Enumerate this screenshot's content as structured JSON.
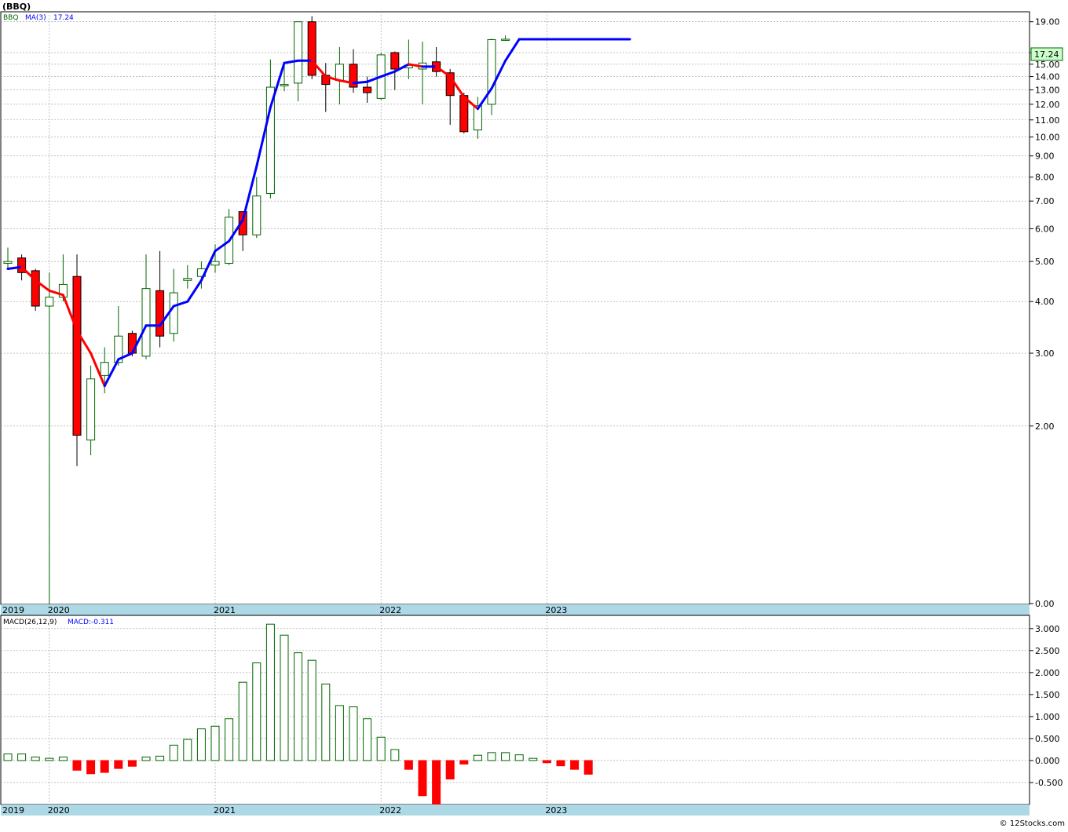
{
  "title": "(BBQ)",
  "watermark": "© 12Stocks.com",
  "colors": {
    "up": "#006400",
    "down": "#ff0000",
    "ma_up": "#0000ff",
    "ma_down": "#ff0000",
    "grid": "#999999",
    "xband": "#add8e6",
    "last_bg": "#ccffcc"
  },
  "price_panel": {
    "symbol_label": "BBQ",
    "ma_label": "MA(3)",
    "ma_value": "17.24",
    "last_price_label": "17.24",
    "scale": "log",
    "y_ticks": [
      "19.00",
      "16.00",
      "15.00",
      "14.00",
      "13.00",
      "12.00",
      "11.00",
      "10.00",
      "9.00",
      "8.00",
      "7.00",
      "6.00",
      "5.00",
      "4.00",
      "3.00",
      "2.00",
      "0.00"
    ]
  },
  "macd_panel": {
    "label": "MACD(26,12,9)",
    "value_label": "MACD:-0.311",
    "y_ticks": [
      "3.000",
      "2.500",
      "2.000",
      "1.500",
      "1.000",
      "0.500",
      "0.000",
      "-0.500"
    ]
  },
  "x_labels": [
    "2019",
    "2020",
    "2021",
    "2022",
    "2023"
  ],
  "chart_data": [
    {
      "type": "candlestick",
      "interval": "monthly",
      "scale": "log",
      "candles": [
        {
          "date": "2019-12",
          "open": 4.95,
          "high": 5.4,
          "low": 4.8,
          "close": 5.0
        },
        {
          "date": "2020-01",
          "open": 5.1,
          "high": 5.2,
          "low": 4.5,
          "close": 4.7
        },
        {
          "date": "2020-02",
          "open": 4.75,
          "high": 4.8,
          "low": 3.8,
          "close": 3.9
        },
        {
          "date": "2020-03",
          "open": 3.9,
          "high": 4.7,
          "low": 0.7,
          "close": 4.1
        },
        {
          "date": "2020-04",
          "open": 4.1,
          "high": 5.2,
          "low": 4.0,
          "close": 4.4
        },
        {
          "date": "2020-05",
          "open": 4.6,
          "high": 5.2,
          "low": 1.6,
          "close": 1.9
        },
        {
          "date": "2020-06",
          "open": 1.85,
          "high": 2.8,
          "low": 1.7,
          "close": 2.6
        },
        {
          "date": "2020-07",
          "open": 2.65,
          "high": 3.1,
          "low": 2.4,
          "close": 2.85
        },
        {
          "date": "2020-08",
          "open": 2.85,
          "high": 3.9,
          "low": 2.8,
          "close": 3.3
        },
        {
          "date": "2020-09",
          "open": 3.35,
          "high": 3.4,
          "low": 2.95,
          "close": 3.0
        },
        {
          "date": "2020-10",
          "open": 2.95,
          "high": 5.2,
          "low": 2.9,
          "close": 4.3
        },
        {
          "date": "2020-11",
          "open": 4.25,
          "high": 5.3,
          "low": 3.1,
          "close": 3.3
        },
        {
          "date": "2020-12",
          "open": 3.35,
          "high": 4.8,
          "low": 3.2,
          "close": 4.2
        },
        {
          "date": "2021-01",
          "open": 4.5,
          "high": 4.9,
          "low": 4.3,
          "close": 4.55
        },
        {
          "date": "2021-02",
          "open": 4.6,
          "high": 5.0,
          "low": 4.3,
          "close": 4.8
        },
        {
          "date": "2021-03",
          "open": 4.9,
          "high": 5.5,
          "low": 4.7,
          "close": 5.0
        },
        {
          "date": "2021-04",
          "open": 4.95,
          "high": 6.7,
          "low": 4.9,
          "close": 6.4
        },
        {
          "date": "2021-05",
          "open": 6.6,
          "high": 6.6,
          "low": 5.3,
          "close": 5.8
        },
        {
          "date": "2021-06",
          "open": 5.8,
          "high": 8.0,
          "low": 5.7,
          "close": 7.2
        },
        {
          "date": "2021-07",
          "open": 7.3,
          "high": 15.4,
          "low": 7.1,
          "close": 13.2
        },
        {
          "date": "2021-08",
          "open": 13.3,
          "high": 15.2,
          "low": 12.9,
          "close": 13.4
        },
        {
          "date": "2021-09",
          "open": 13.5,
          "high": 19.0,
          "low": 12.2,
          "close": 19.0
        },
        {
          "date": "2021-10",
          "open": 19.0,
          "high": 19.6,
          "low": 13.8,
          "close": 14.1
        },
        {
          "date": "2021-11",
          "open": 14.1,
          "high": 15.1,
          "low": 11.5,
          "close": 13.4
        },
        {
          "date": "2021-12",
          "open": 13.7,
          "high": 16.5,
          "low": 12.0,
          "close": 15.0
        },
        {
          "date": "2022-01",
          "open": 15.0,
          "high": 16.3,
          "low": 12.8,
          "close": 13.2
        },
        {
          "date": "2022-02",
          "open": 13.2,
          "high": 14.0,
          "low": 12.1,
          "close": 12.8
        },
        {
          "date": "2022-03",
          "open": 12.4,
          "high": 16.0,
          "low": 12.3,
          "close": 15.8
        },
        {
          "date": "2022-04",
          "open": 16.0,
          "high": 16.1,
          "low": 13.0,
          "close": 14.6
        },
        {
          "date": "2022-05",
          "open": 14.7,
          "high": 17.2,
          "low": 13.8,
          "close": 14.9
        },
        {
          "date": "2022-06",
          "open": 14.6,
          "high": 17.0,
          "low": 12.0,
          "close": 15.1
        },
        {
          "date": "2022-07",
          "open": 15.2,
          "high": 16.5,
          "low": 14.0,
          "close": 14.4
        },
        {
          "date": "2022-08",
          "open": 14.3,
          "high": 14.6,
          "low": 10.7,
          "close": 12.6
        },
        {
          "date": "2022-09",
          "open": 12.6,
          "high": 12.8,
          "low": 10.2,
          "close": 10.3
        },
        {
          "date": "2022-10",
          "open": 10.4,
          "high": 12.5,
          "low": 9.9,
          "close": 11.9
        },
        {
          "date": "2022-11",
          "open": 12.0,
          "high": 17.3,
          "low": 11.3,
          "close": 17.2
        },
        {
          "date": "2022-12",
          "open": 17.2,
          "high": 17.6,
          "low": 17.1,
          "close": 17.24
        }
      ],
      "ma3": [
        4.8,
        4.85,
        4.5,
        4.25,
        4.15,
        3.4,
        3.0,
        2.5,
        2.9,
        3.0,
        3.5,
        3.5,
        3.9,
        4.0,
        4.5,
        5.3,
        5.6,
        6.3,
        8.5,
        11.8,
        15.1,
        15.3,
        15.3,
        14.0,
        13.7,
        13.5,
        13.6,
        14.0,
        14.4,
        15.0,
        14.8,
        14.8,
        14.0,
        12.5,
        11.7,
        13.1,
        15.3,
        17.24,
        17.24,
        17.24,
        17.24,
        17.24,
        17.24,
        17.24,
        17.24,
        17.24
      ]
    },
    {
      "type": "bar",
      "name": "MACD(26,12,9)",
      "interval": "monthly",
      "values": [
        0.15,
        0.15,
        0.08,
        0.05,
        0.08,
        -0.22,
        -0.3,
        -0.27,
        -0.18,
        -0.13,
        0.08,
        0.1,
        0.35,
        0.48,
        0.72,
        0.78,
        0.95,
        1.78,
        2.22,
        3.1,
        2.85,
        2.45,
        2.28,
        1.74,
        1.25,
        1.22,
        0.95,
        0.53,
        0.25,
        -0.2,
        -0.8,
        -1.05,
        -0.42,
        -0.08,
        0.12,
        0.18,
        0.18,
        0.13,
        0.05,
        -0.05,
        -0.12,
        -0.2,
        -0.311
      ],
      "ylim": [
        -1.0,
        3.3
      ]
    }
  ]
}
